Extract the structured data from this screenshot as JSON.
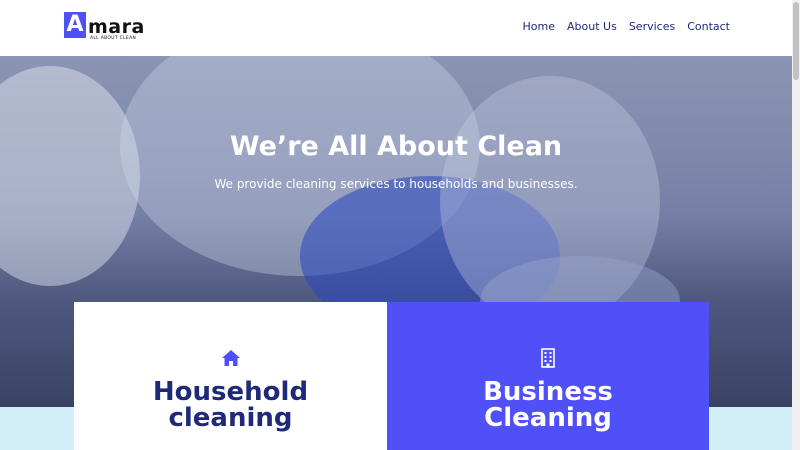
{
  "header": {
    "logo_letter": "A",
    "logo_word": "mara",
    "logo_tagline": "ALL ABOUT CLEAN",
    "nav": [
      "Home",
      "About Us",
      "Services",
      "Contact"
    ]
  },
  "hero": {
    "title": "We’re All About Clean",
    "subtitle": "We provide cleaning services to households and businesses."
  },
  "cards": {
    "household": {
      "icon": "house-icon",
      "title_line1": "Household",
      "title_line2": "cleaning"
    },
    "business": {
      "icon": "building-icon",
      "title_line1": "Business",
      "title_line2": "Cleaning"
    }
  },
  "colors": {
    "accent": "#4f50f7",
    "navy": "#1e2a78",
    "band": "#d2eef9"
  }
}
